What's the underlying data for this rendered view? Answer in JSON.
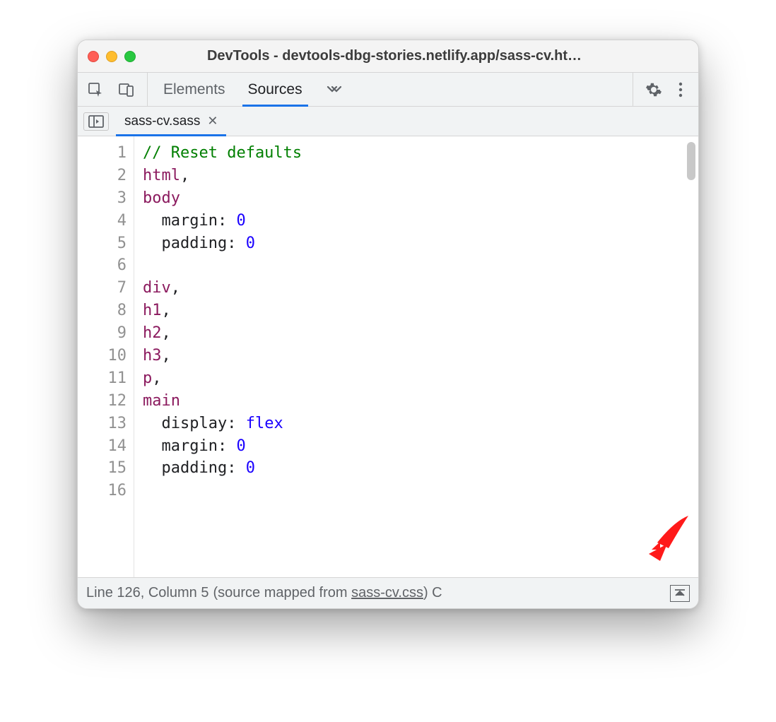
{
  "window_title": "DevTools - devtools-dbg-stories.netlify.app/sass-cv.ht…",
  "tabs": {
    "elements": "Elements",
    "sources": "Sources"
  },
  "file_tab": "sass-cv.sass",
  "code": {
    "line1_comment": "// Reset defaults",
    "sel_html": "html",
    "sel_body": "body",
    "sel_div": "div",
    "sel_h1": "h1",
    "sel_h2": "h2",
    "sel_h3": "h3",
    "sel_p": "p",
    "sel_main": "main",
    "comma": ",",
    "prop_margin": "margin",
    "prop_padding": "padding",
    "prop_display": "display",
    "val_zero": "0",
    "val_flex": "flex",
    "colon": ": "
  },
  "lines": [
    "1",
    "2",
    "3",
    "4",
    "5",
    "6",
    "7",
    "8",
    "9",
    "10",
    "11",
    "12",
    "13",
    "14",
    "15",
    "16"
  ],
  "status": {
    "pos": "Line 126, Column 5",
    "mapped_prefix": "(source mapped from ",
    "mapped_link": "sass-cv.css",
    "mapped_suffix": ")",
    "trailing": " C"
  }
}
